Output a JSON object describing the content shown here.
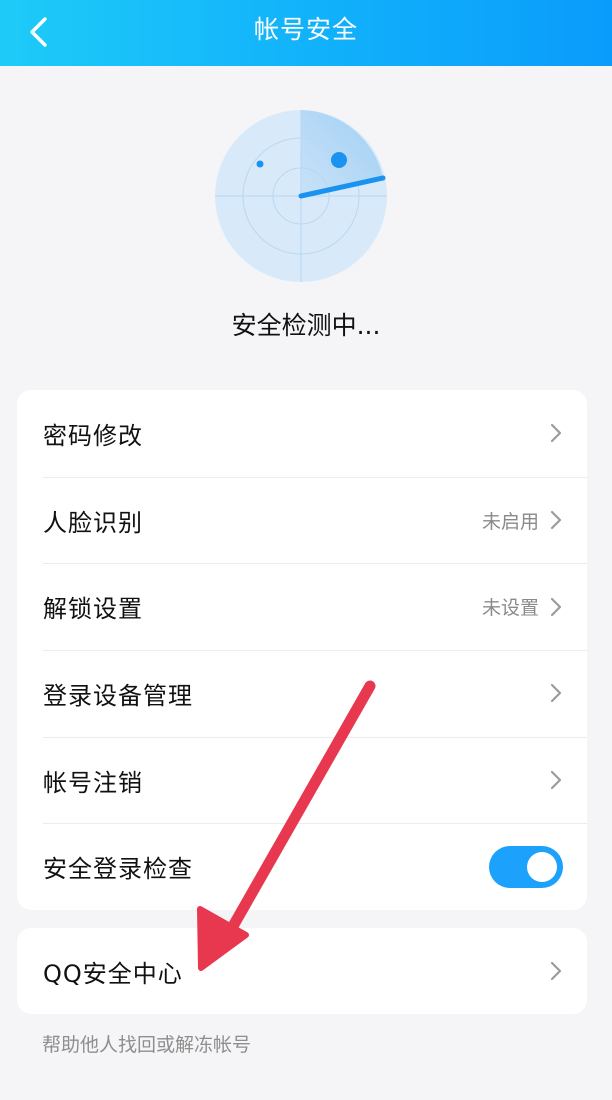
{
  "header": {
    "title": "帐号安全"
  },
  "scan": {
    "status": "安全检测中..."
  },
  "settings": {
    "items": [
      {
        "label": "密码修改",
        "value": ""
      },
      {
        "label": "人脸识别",
        "value": "未启用"
      },
      {
        "label": "解锁设置",
        "value": "未设置"
      },
      {
        "label": "登录设备管理",
        "value": ""
      },
      {
        "label": "帐号注销",
        "value": ""
      },
      {
        "label": "安全登录检查",
        "toggle": true
      }
    ]
  },
  "qq_center": {
    "label": "QQ安全中心"
  },
  "footer": {
    "link": "帮助他人找回或解冻帐号"
  },
  "icons": {
    "back": "chevron-left-icon",
    "row_arrow": "chevron-right-icon",
    "radar": "radar-icon"
  },
  "colors": {
    "header_start": "#1ecbf8",
    "header_end": "#0a9cfb",
    "toggle_on": "#1ca1fc",
    "annotation_arrow": "#e8384f",
    "radar_fill": "#d8eaf9",
    "radar_accent": "#1a93f0"
  }
}
